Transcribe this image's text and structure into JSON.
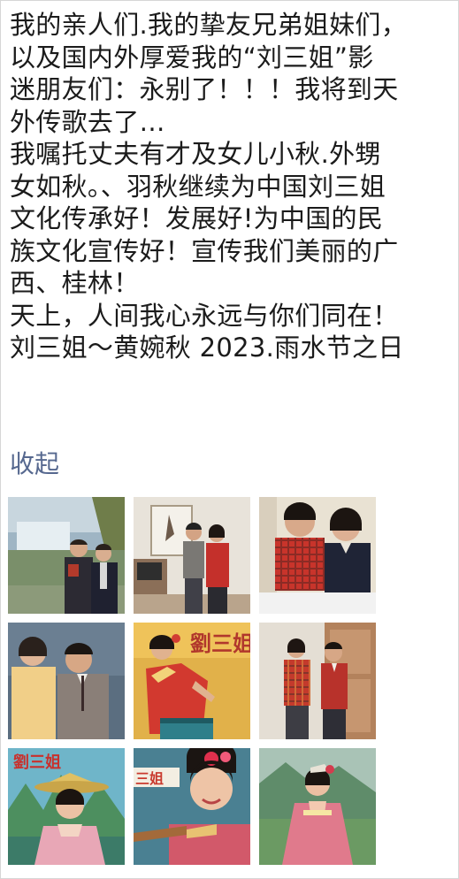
{
  "post": {
    "lines": [
      "我的亲人们.我的挚友兄弟姐妹们，",
      "以及国内外厚爱我的“刘三姐”影",
      "迷朋友们：永别了！！！我将到天",
      "外传歌去了…",
      "我嘱托丈夫有才及女儿小秋.外甥",
      "女如秋。、羽秋继续为中国刘三姐",
      "文化传承好！发展好!为中国的民",
      "族文化宣传好！宣传我们美丽的广",
      "西、桂林！",
      "天上，人间我心永远与你们同在！",
      "刘三姐～黄婉秋 2023.雨水节之日"
    ],
    "collapse_label": "收起"
  },
  "photos": {
    "poster_title_1": "劉三姐",
    "poster_title_2": "劉三姐",
    "poster_title_3": "三姐",
    "poster_title_3_prefix": "刘"
  },
  "colors": {
    "text": "#1b1b1b",
    "link": "#56688f",
    "border": "#d6d6d6"
  }
}
